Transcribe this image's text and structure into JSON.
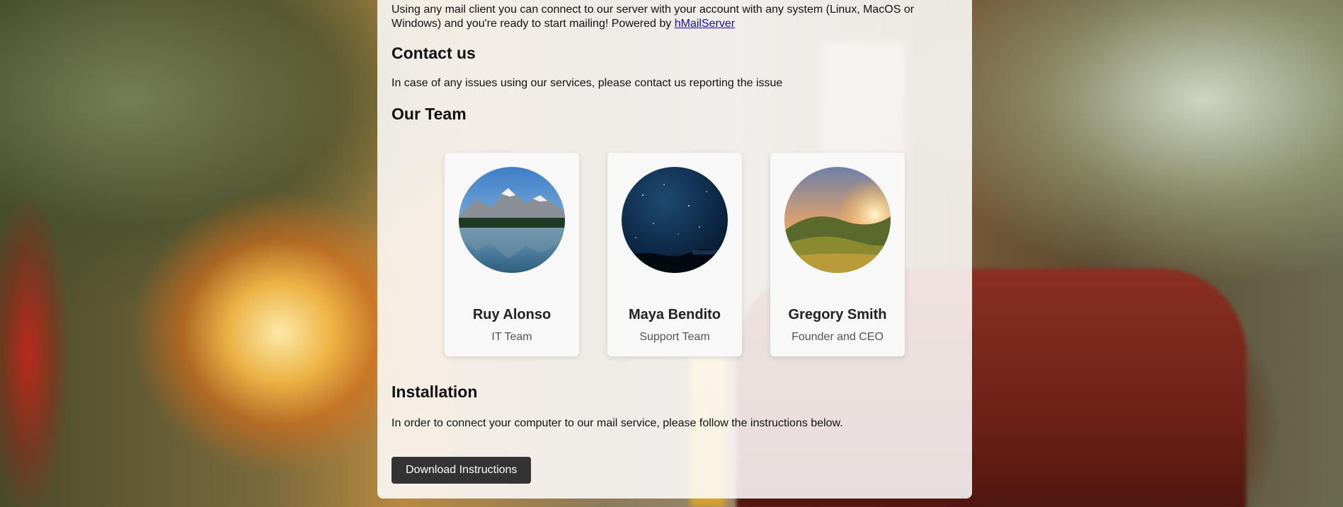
{
  "intro": {
    "text": "Using any mail client you can connect to our server with your account with any system (Linux, MacOS or Windows) and you're ready to start mailing! Powered by ",
    "link_label": "hMailServer"
  },
  "contact": {
    "heading": "Contact us",
    "text": "In case of any issues using our services, please contact us reporting the issue"
  },
  "team": {
    "heading": "Our Team",
    "members": [
      {
        "name": "Ruy Alonso",
        "role": "IT Team",
        "avatar": "mountain-lake-photo"
      },
      {
        "name": "Maya Bendito",
        "role": "Support Team",
        "avatar": "starry-night-photo"
      },
      {
        "name": "Gregory Smith",
        "role": "Founder and CEO",
        "avatar": "sunset-hills-photo"
      }
    ]
  },
  "installation": {
    "heading": "Installation",
    "text": "In order to connect your computer to our mail service, please follow the instructions below.",
    "button_label": "Download Instructions"
  },
  "colors": {
    "link": "#1a0dab",
    "button_bg": "#333333",
    "panel_bg": "rgba(255,255,255,0.86)"
  }
}
